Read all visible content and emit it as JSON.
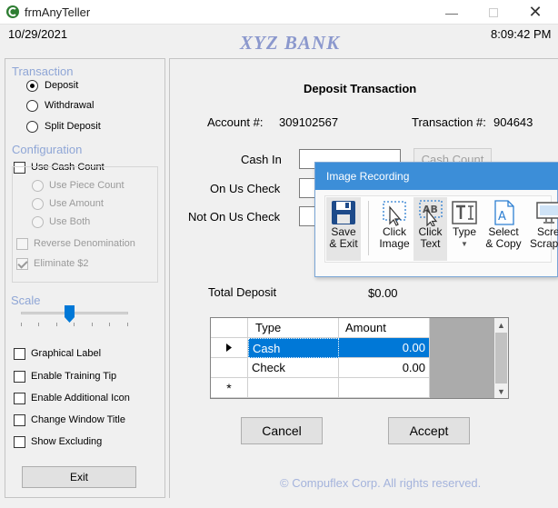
{
  "window": {
    "title": "frmAnyTeller"
  },
  "header": {
    "date": "10/29/2021",
    "bank_name": "XYZ BANK",
    "time": "8:09:42 PM"
  },
  "sidebar": {
    "transaction": {
      "title": "Transaction",
      "options": [
        {
          "label": "Deposit",
          "selected": true
        },
        {
          "label": "Withdrawal",
          "selected": false
        },
        {
          "label": "Split Deposit",
          "selected": false
        }
      ]
    },
    "configuration": {
      "title": "Configuration",
      "use_cash_count": "Use Cash Count",
      "use_piece_count": "Use Piece Count",
      "use_amount": "Use Amount",
      "use_both": "Use Both",
      "reverse_denomination": "Reverse Denomination",
      "eliminate_2": "Eliminate $2"
    },
    "scale": {
      "title": "Scale",
      "level": 0.45
    },
    "options": {
      "graphical_label": "Graphical Label",
      "enable_training_tip": "Enable Training Tip",
      "enable_additional_icon": "Enable Additional Icon",
      "change_window_title": "Change Window Title",
      "show_excluding": "Show Excluding"
    },
    "exit_label": "Exit"
  },
  "main": {
    "heading": "Deposit Transaction",
    "account_label": "Account #:",
    "account_number": "309102567",
    "transaction_label": "Transaction #:",
    "transaction_number": "904643",
    "cash_in_label": "Cash In",
    "cash_count_label": "Cash Count",
    "on_us_check_label": "On Us Check",
    "not_on_us_check_label": "Not On Us Check",
    "total_deposit_label": "Total Deposit",
    "total_deposit_value": "$0.00",
    "grid": {
      "columns": [
        "Type",
        "Amount"
      ],
      "rows": [
        {
          "type": "Cash",
          "amount": "0.00"
        },
        {
          "type": "Check",
          "amount": "0.00"
        }
      ],
      "new_row_marker": "*"
    },
    "cancel_label": "Cancel",
    "accept_label": "Accept",
    "copyright": "© Compuflex Corp. All rights reserved."
  },
  "popup": {
    "title": "Image Recording",
    "tools": {
      "save_exit": [
        "Save",
        "& Exit"
      ],
      "click_image": [
        "Click",
        "Image"
      ],
      "click_text": [
        "Click",
        "Text"
      ],
      "type": [
        "Type"
      ],
      "select_copy": [
        "Select",
        "& Copy"
      ],
      "screen_scraping": [
        "Scree",
        "Scrapin"
      ]
    }
  },
  "colors": {
    "bank_name": "#8b98cd",
    "group_title": "#8fa6d6",
    "popup_title_bg": "#3c8ed8",
    "grid_selection": "#0078d7",
    "copyright": "#a4b3dc"
  },
  "icons": [
    "app-icon",
    "minimize-icon",
    "maximize-icon",
    "close-icon",
    "save-icon",
    "click-image-icon",
    "click-text-icon",
    "type-icon",
    "select-copy-icon",
    "screen-icon"
  ]
}
